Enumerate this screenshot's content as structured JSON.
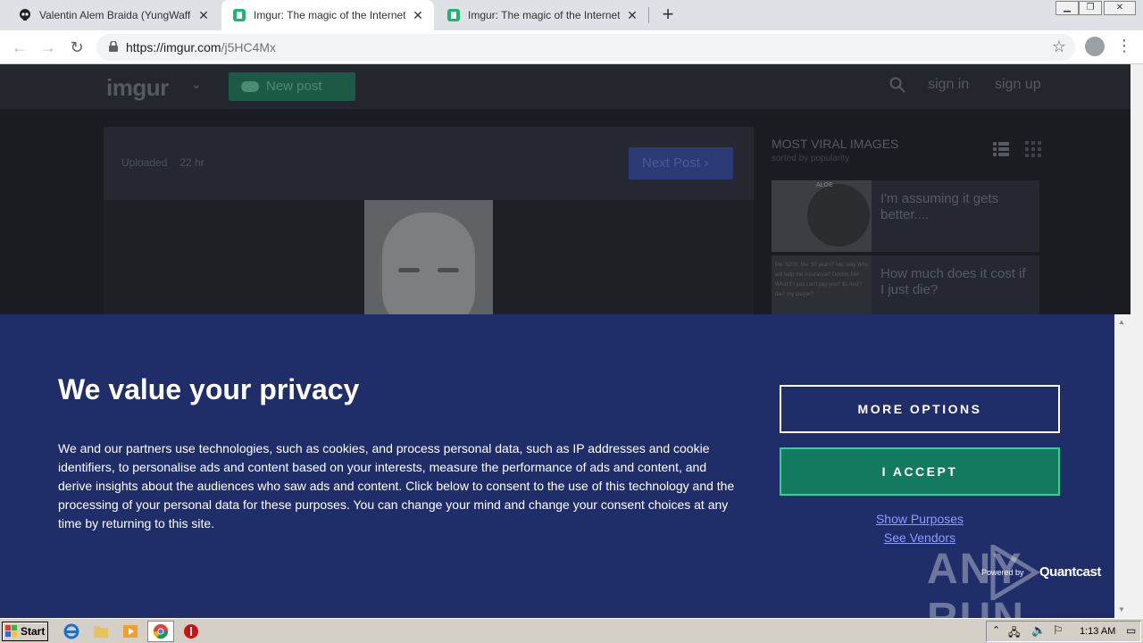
{
  "browser": {
    "tabs": [
      {
        "title": "Valentin Alem Braida (YungWaffen) -",
        "active": false
      },
      {
        "title": "Imgur: The magic of the Internet",
        "active": true
      },
      {
        "title": "Imgur: The magic of the Internet",
        "active": false
      }
    ],
    "url_host": "https://imgur.com",
    "url_path": "/j5HC4Mx"
  },
  "imgur": {
    "logo": "imgur",
    "new_post": "New post",
    "sign_in": "sign in",
    "sign_up": "sign up",
    "uploaded_label": "Uploaded",
    "uploaded_ago": "22 hr",
    "next_post": "Next Post",
    "sidebar_title": "MOST VIRAL IMAGES",
    "sidebar_subtitle": "sorted by popularity",
    "viral_items": [
      {
        "title": "I'm assuming it gets better....",
        "thumb_text": "ALOE"
      },
      {
        "title": "How much does it cost if I just die?",
        "thumb_text": "Me: $200. Me: 50 years? Me: way Who will help me insurance? Doctor: Me: What if I just can't pay you? $1 And I die? my lawyer?"
      }
    ]
  },
  "consent": {
    "title": "We value your privacy",
    "body": "We and our partners use technologies, such as cookies, and process personal data, such as IP addresses and cookie identifiers, to personalise ads and content based on your interests, measure the performance of ads and content, and derive insights about the audiences who saw ads and content. Click below to consent to the use of this technology and the processing of your personal data for these purposes. You can change your mind and change your consent choices at any time by returning to this site.",
    "more_options": "MORE OPTIONS",
    "accept": "I ACCEPT",
    "show_purposes": "Show Purposes",
    "see_vendors": "See Vendors",
    "powered_by": "Powered by",
    "brand": "Quantcast",
    "watermark": "ANY RUN"
  },
  "taskbar": {
    "start": "Start",
    "clock": "1:13 AM"
  },
  "colors": {
    "consent_bg": "#1f2d68",
    "accept_bg": "#127a5e",
    "link": "#8c9dff"
  }
}
